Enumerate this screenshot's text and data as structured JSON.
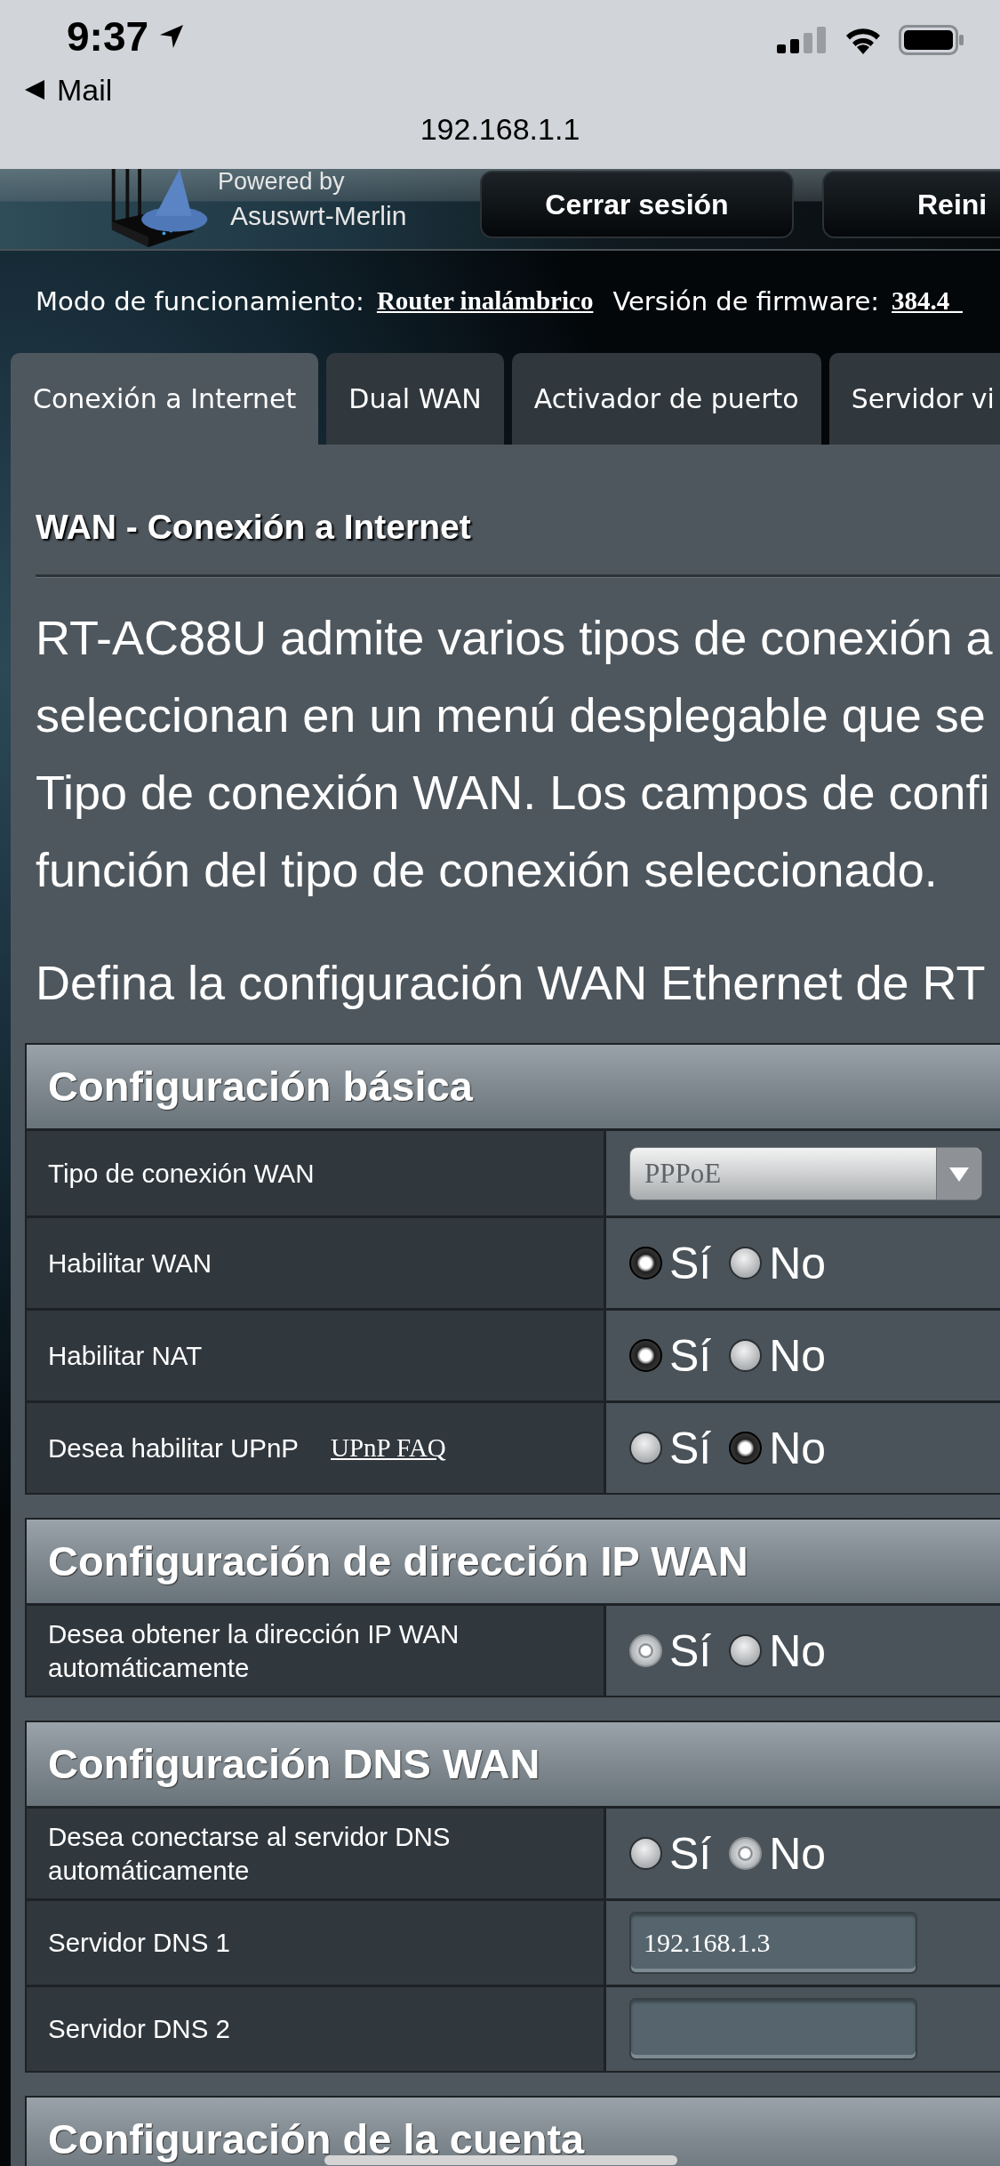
{
  "status_bar": {
    "time": "9:37",
    "back_label": "Mail",
    "url": "192.168.1.1"
  },
  "header": {
    "powered_by": "Powered by",
    "brand": "Asuswrt-Merlin",
    "buttons": [
      "Cerrar sesión",
      "Reini"
    ]
  },
  "info_bar": [
    {
      "label": "Modo de funcionamiento:",
      "value": "Router inalámbrico"
    },
    {
      "label": "Versión de firmware:",
      "value": "384.4_"
    }
  ],
  "tabs": [
    {
      "label": "Conexión a Internet",
      "selected": true
    },
    {
      "label": "Dual WAN",
      "selected": false
    },
    {
      "label": "Activador de puerto",
      "selected": false
    },
    {
      "label": "Servidor vi",
      "selected": false
    }
  ],
  "page_title": "WAN - Conexión a Internet",
  "description_lines": [
    "RT-AC88U admite varios tipos de conexión a",
    "seleccionan en un menú desplegable que se",
    "Tipo de conexión WAN. Los campos de confi",
    "función del tipo de conexión seleccionado."
  ],
  "instruction": "Defina la configuración WAN Ethernet de RT",
  "sections": [
    {
      "title": "Configuración básica",
      "rows": [
        {
          "kind": "select",
          "label": "Tipo de conexión WAN",
          "value": "PPPoE"
        },
        {
          "kind": "radio",
          "label": "Habilitar WAN",
          "options": [
            {
              "label": "Sí",
              "selected": true,
              "disabled": false
            },
            {
              "label": "No",
              "selected": false,
              "disabled": false
            }
          ]
        },
        {
          "kind": "radio",
          "label": "Habilitar NAT",
          "options": [
            {
              "label": "Sí",
              "selected": true,
              "disabled": false
            },
            {
              "label": "No",
              "selected": false,
              "disabled": false
            }
          ]
        },
        {
          "kind": "radio",
          "label": "Desea habilitar UPnP",
          "link": "UPnP FAQ",
          "options": [
            {
              "label": "Sí",
              "selected": false,
              "disabled": false
            },
            {
              "label": "No",
              "selected": true,
              "disabled": false
            }
          ]
        }
      ]
    },
    {
      "title": "Configuración de dirección IP WAN",
      "rows": [
        {
          "kind": "radio",
          "label": "Desea obtener la dirección IP WAN automáticamente",
          "options": [
            {
              "label": "Sí",
              "selected": true,
              "disabled": true
            },
            {
              "label": "No",
              "selected": false,
              "disabled": false
            }
          ]
        }
      ]
    },
    {
      "title": "Configuración DNS WAN",
      "rows": [
        {
          "kind": "radio",
          "label": "Desea conectarse al servidor DNS automáticamente",
          "options": [
            {
              "label": "Sí",
              "selected": false,
              "disabled": false
            },
            {
              "label": "No",
              "selected": true,
              "disabled": true
            }
          ]
        },
        {
          "kind": "text",
          "label": "Servidor DNS 1",
          "value": "192.168.1.3"
        },
        {
          "kind": "text",
          "label": "Servidor DNS 2"
        }
      ]
    },
    {
      "title": "Configuración de la cuenta"
    }
  ]
}
